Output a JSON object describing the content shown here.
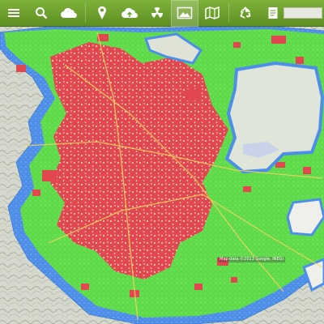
{
  "toolbar": {
    "buttons": [
      {
        "icon": "menu-icon"
      },
      {
        "icon": "search-icon"
      },
      {
        "icon": "cloud-icon"
      },
      {
        "icon": "map-pin-icon"
      },
      {
        "icon": "cloud-upload-icon"
      },
      {
        "icon": "radiation-icon"
      },
      {
        "icon": "photo-icon"
      },
      {
        "icon": "map-icon"
      },
      {
        "icon": "recycle-icon"
      },
      {
        "icon": "document-icon"
      }
    ],
    "search": {
      "placeholder": ""
    },
    "accent_color": "#6aa22c",
    "active_button_icon": "photo-icon"
  },
  "map": {
    "legend_colors": {
      "high_density": "#e0474f",
      "medium_density": "#5edb48",
      "low_density": "#4d8fe8"
    },
    "attribution": "Map data ©2013 Google, INEGI"
  }
}
